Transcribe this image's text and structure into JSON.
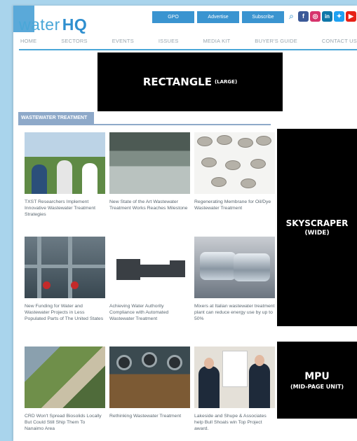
{
  "header": {
    "logo_light": "water",
    "logo_bold": "HQ",
    "buttons": [
      "GPO",
      "Advertise",
      "Subscribe"
    ],
    "social_icons": [
      "search-icon",
      "facebook-icon",
      "instagram-icon",
      "linkedin-icon",
      "twitter-icon",
      "youtube-icon"
    ]
  },
  "nav": [
    "HOME",
    "SECTORS",
    "EVENTS",
    "ISSUES",
    "MEDIA KIT",
    "BUYER'S GUIDE",
    "CONTACT US"
  ],
  "ads": {
    "rectangle": "RECTANGLE",
    "rectangle_sub": "(LARGE)",
    "skyscraper": "SKYSCRAPER",
    "skyscraper_sub": "(WIDE)",
    "mpu": "MPU",
    "mpu_sub": "(MID-PAGE UNIT)"
  },
  "section": {
    "title": "WASTEWATER TREATMENT"
  },
  "articles": [
    {
      "caption": "TXST Researchers Implement Innovative Wastewater Treatment Strategies"
    },
    {
      "caption": "New State of the Art Wastewater Treatment Works Reaches Milestone"
    },
    {
      "caption": "Regenerating Membrane for Oil/Dye Wastewater Treatment"
    },
    {
      "caption": "New Funding for Water and Wastewater Projects in Less Populated Parts of The United States"
    },
    {
      "caption": "Achieving Water Authority Compliance with Automated Wastewater Treatment"
    },
    {
      "caption": "Mixers at Italian wastewater treatment plant can reduce energy use by up to 50%"
    },
    {
      "caption": "CRD Won't Spread Biosolids Locally But Could Still Ship Them To Nanaimo Area"
    },
    {
      "caption": "Rethinking Wastewater Treatment"
    },
    {
      "caption": "Lakeside and Shupe & Associates help Bull Shoals win Top Project award."
    }
  ],
  "colors": {
    "accent": "#3a94d0",
    "section_tab": "#8ea9c9",
    "page_bg": "#a9d4ec"
  }
}
